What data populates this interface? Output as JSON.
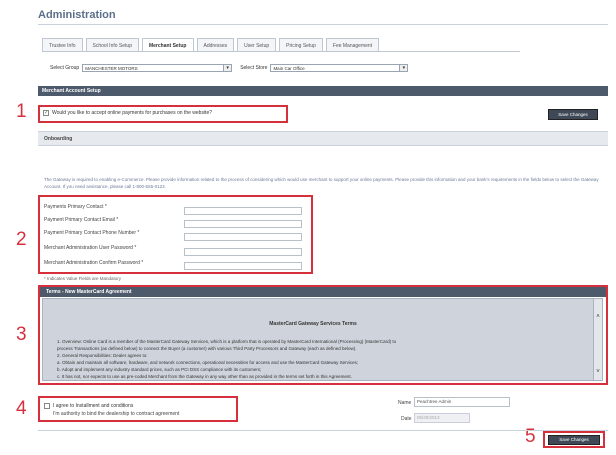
{
  "page": {
    "title": "Administration"
  },
  "tabs": [
    {
      "label": "Trustee Info"
    },
    {
      "label": "School Info Setup"
    },
    {
      "label": "Merchant Setup"
    },
    {
      "label": "Addresses"
    },
    {
      "label": "User Setup"
    },
    {
      "label": "Pricing Setup"
    },
    {
      "label": "Fee Management"
    }
  ],
  "selectors": {
    "group_label": "Select Group",
    "group_value": "MANCHESTER MOTORS",
    "store_label": "Select Store",
    "store_value": "Main Car Office"
  },
  "merchant_section": {
    "header": "Merchant Account Setup",
    "accept_question": "Would you like to accept online payments for purchases on the website?",
    "save_button": "Save Changes"
  },
  "onboarding": {
    "header": "Onboarding",
    "info_text": "The Gateway is required to enabling e-Commerce. Please provide information related to the process of considering which would use merchant to support your online payments. Please provide this information and your bank's requirements in the fields below to select the Gateway Account. If you need assistance, please call 1-800-555-0123."
  },
  "contact_fields": [
    {
      "label": "Payments Primary Contact *"
    },
    {
      "label": "Payment Primary Contact Email *"
    },
    {
      "label": "Payment Primary Contact Phone Number *"
    },
    {
      "label": "Merchant Administration User Password *"
    },
    {
      "label": "Merchant Administration Confirm Password *"
    }
  ],
  "contact_note": "* Indicates Value Fields are Mandatory",
  "terms": {
    "header": "Terms - New MasterCard Agreement",
    "title": "MasterCard Gateway Services Terms",
    "lines": [
      "1.  Overview: Online Card is a member of the MasterCard Gateway Services, which is a platform that is operated by MasterCard International (Processing) (MasterCard) to",
      "     process Transactions (as defined below) to connect the Buyer (a customer) with various Third Party Processors and Gateway (each as defined below).",
      "2.  General Responsibilities: Dealer agrees to:",
      "     a.    Obtain and maintain all software, hardware, and network connections, operational necessities for access and use the MasterCard Gateway Services;",
      "     b.    Adopt and implement any industry standard prices, such as PCI DSS compliance with its customers;",
      "     c.    It has not, nor expects to use as pre-coded Merchant from the Gateway in any way other than as provided in the terms set forth in this Agreement."
    ]
  },
  "agreement": {
    "checkbox_line1": "I agree to Installment and conditions",
    "checkbox_line2": "I'm authority to bind the dealership to contract agreement",
    "name_label": "Name",
    "name_value": "Peachtree Admin",
    "date_label": "Date",
    "date_value": "05/30/2013",
    "save_button": "Save Changes"
  },
  "callout_numbers": [
    "1",
    "2",
    "3",
    "4",
    "5"
  ],
  "colors": {
    "callout": "#d6303d",
    "header_bar": "#4d5a6b",
    "title": "#5b6f8a"
  }
}
